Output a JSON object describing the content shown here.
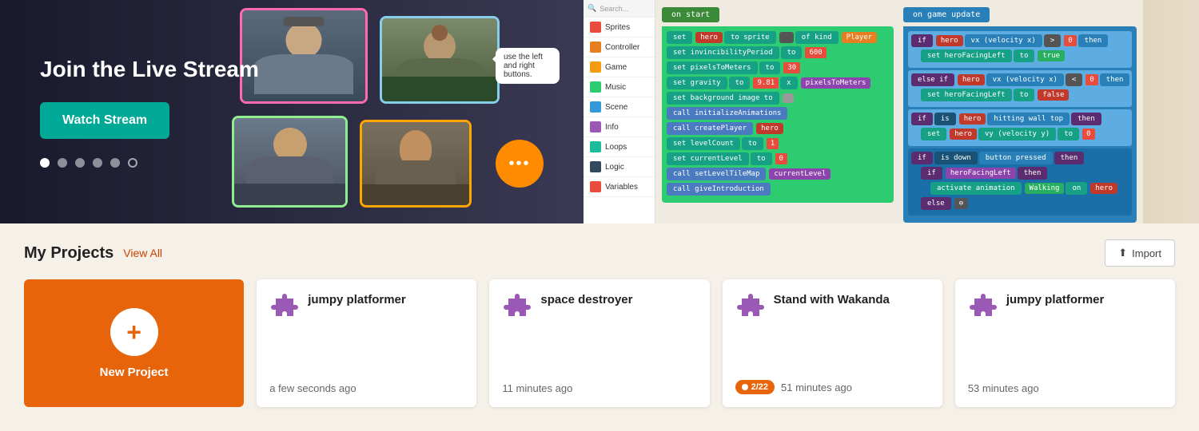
{
  "hero": {
    "title": "Join the Live Stream",
    "watch_btn": "Watch Stream",
    "chat_text": "use the left and right buttons.",
    "dots": [
      {
        "active": true
      },
      {
        "active": false
      },
      {
        "active": false
      },
      {
        "active": false
      },
      {
        "active": false
      },
      {
        "active": false,
        "outline": true
      }
    ]
  },
  "makecode_sidebar": {
    "search_placeholder": "Search...",
    "menu_items": [
      {
        "label": "Sprites",
        "color": "#e74c3c"
      },
      {
        "label": "Controller",
        "color": "#e67e22"
      },
      {
        "label": "Game",
        "color": "#f39c12"
      },
      {
        "label": "Music",
        "color": "#2ecc71"
      },
      {
        "label": "Scene",
        "color": "#3498db"
      },
      {
        "label": "Info",
        "color": "#9b59b6"
      },
      {
        "label": "Loops",
        "color": "#1abc9c"
      },
      {
        "label": "Logic",
        "color": "#34495e"
      },
      {
        "label": "Variables",
        "color": "#e74c3c"
      }
    ]
  },
  "projects": {
    "title": "My Projects",
    "view_all": "View All",
    "import_btn": "Import",
    "new_project_label": "New Project",
    "items": [
      {
        "name": "jumpy platformer",
        "time": "a few seconds ago",
        "has_progress": false
      },
      {
        "name": "space destroyer",
        "time": "11 minutes ago",
        "has_progress": false
      },
      {
        "name": "Stand with Wakanda",
        "time": "51 minutes ago",
        "has_progress": true,
        "progress": "2/22"
      },
      {
        "name": "jumpy platformer",
        "time": "53 minutes ago",
        "has_progress": false
      }
    ]
  }
}
